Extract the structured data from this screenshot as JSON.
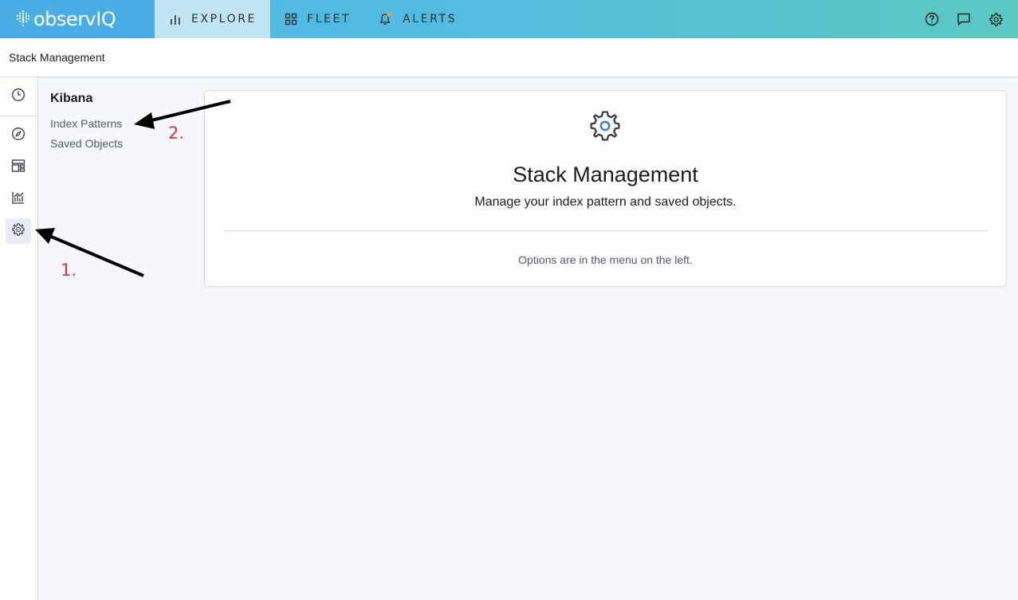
{
  "brand": {
    "name": "observIQ"
  },
  "topnav": {
    "tabs": [
      {
        "label": "EXPLORE",
        "icon": "bar-chart-icon",
        "active": true
      },
      {
        "label": "FLEET",
        "icon": "grid-icon",
        "active": false
      },
      {
        "label": "ALERTS",
        "icon": "bell-icon",
        "active": false
      }
    ],
    "right_icons": [
      "help-icon",
      "feedback-icon",
      "settings-icon"
    ]
  },
  "header": {
    "breadcrumb": "Stack Management"
  },
  "sidenav": {
    "items": [
      "clock-icon",
      "compass-icon",
      "dashboard-icon",
      "visualize-icon",
      "gear-icon"
    ],
    "active": "gear-icon"
  },
  "submenu": {
    "title": "Kibana",
    "items": [
      "Index Patterns",
      "Saved Objects"
    ]
  },
  "main": {
    "icon": "gear-icon",
    "title": "Stack Management",
    "subtitle": "Manage your index pattern and saved objects.",
    "note": "Options are in the menu on the left."
  },
  "annotations": {
    "step1": "1.",
    "step2": "2."
  },
  "colors": {
    "brand": "#4aaee6",
    "active_tab": "#bfe5f3",
    "annotation": "#e8312b",
    "accent": "#3f7fd0"
  }
}
